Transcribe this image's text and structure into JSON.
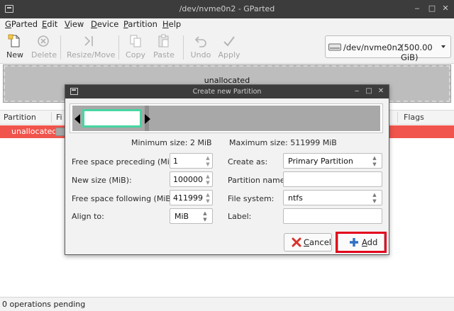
{
  "window": {
    "title": "/dev/nvme0n2 - GParted",
    "minimize": "‒",
    "maximize": "□",
    "close": "✕"
  },
  "menu": [
    {
      "label": "GParted",
      "u": "G",
      "rest": "Parted"
    },
    {
      "label": "Edit",
      "u": "E",
      "rest": "dit"
    },
    {
      "label": "View",
      "u": "V",
      "rest": "iew"
    },
    {
      "label": "Device",
      "u": "D",
      "rest": "evice"
    },
    {
      "label": "Partition",
      "u": "P",
      "rest": "artition"
    },
    {
      "label": "Help",
      "u": "H",
      "rest": "elp"
    }
  ],
  "toolbar": {
    "new": "New",
    "delete": "Delete",
    "resize_move": "Resize/Move",
    "copy": "Copy",
    "paste": "Paste",
    "undo": "Undo",
    "apply": "Apply"
  },
  "device": {
    "path": "/dev/nvme0n2",
    "size": "(500.00 GiB)"
  },
  "diskmap": {
    "label": "unallocated"
  },
  "columns": {
    "partition": "Partition",
    "filesystem_abbrev": "Fi",
    "flags": "Flags"
  },
  "rows": [
    {
      "partition": "unallocated"
    }
  ],
  "status": "0 operations pending",
  "dialog": {
    "title": "Create new Partition",
    "min_size": "Minimum size: 2 MiB",
    "max_size": "Maximum size: 511999 MiB",
    "free_before_label": "Free space preceding (MiB):",
    "free_before_value": "1",
    "new_size_label": "New size (MiB):",
    "new_size_value": "100000",
    "free_after_label": "Free space following (MiB):",
    "free_after_value": "411999",
    "align_label": "Align to:",
    "align_value": "MiB",
    "create_as_label": "Create as:",
    "create_as_value": "Primary Partition",
    "partition_name_label": "Partition name:",
    "partition_name_value": "",
    "filesystem_label": "File system:",
    "filesystem_value": "ntfs",
    "label_label": "Label:",
    "label_value": "",
    "cancel_u": "C",
    "cancel_rest": "ancel",
    "add_u": "A",
    "add_rest": "dd"
  },
  "colors": {
    "titlebar": "#3c3c3c",
    "unallocated_row": "#f0544c",
    "partition_border": "#46d6a2",
    "highlight": "#e3001b",
    "add_icon": "#2f6fc4",
    "cancel_icon": "#d9312b"
  },
  "icons": {
    "new": "new-partition-icon",
    "delete": "delete-icon",
    "resize_move": "resize-move-icon",
    "copy": "copy-icon",
    "paste": "paste-icon",
    "undo": "undo-icon",
    "apply": "apply-icon",
    "device": "drive-icon",
    "add": "plus-icon",
    "cancel": "cancel-icon"
  }
}
